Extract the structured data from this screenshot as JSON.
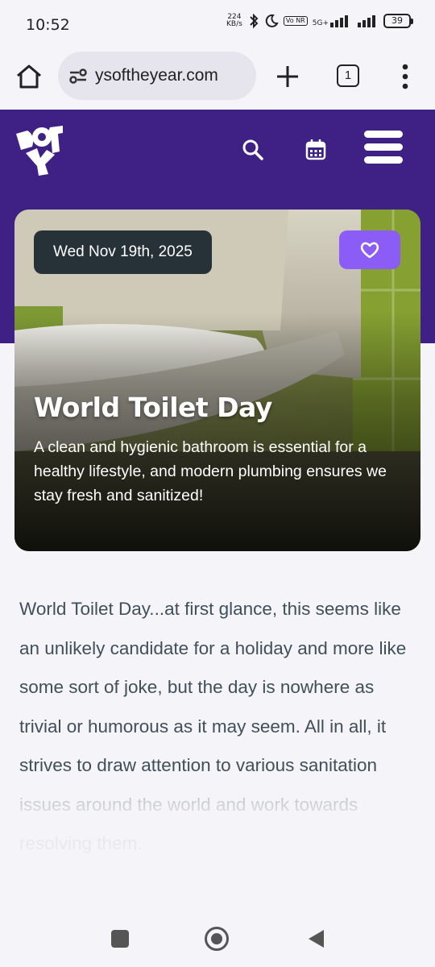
{
  "status_bar": {
    "time": "10:52",
    "net_speed_value": "224",
    "net_speed_unit": "KB/s",
    "volte": "Vo NR",
    "network": "5G+",
    "battery": "39",
    "icons": [
      "bluetooth-icon",
      "moon-icon",
      "signal-icon",
      "battery-icon"
    ]
  },
  "browser": {
    "url": "ysoftheyear.com",
    "tab_count": "1",
    "icons": [
      "home-icon",
      "site-settings-icon",
      "plus-icon",
      "tabs-icon",
      "more-vert-icon"
    ]
  },
  "site": {
    "logo_text": "DOTY",
    "brand_color": "#3f2186",
    "accent_color": "#8b5cf6",
    "icons": [
      "search-icon",
      "calendar-icon",
      "hamburger-menu-icon",
      "heart-icon"
    ]
  },
  "hero": {
    "date": "Wed Nov 19th, 2025",
    "title": "World Toilet Day",
    "description": "A clean and hygienic bathroom is essential for a healthy lifestyle, and modern plumbing ensures we stay fresh and sanitized!"
  },
  "article": {
    "paragraph": "World Toilet Day...at first glance, this seems like an unlikely candidate for a holiday and more like some sort of joke, but the day is nowhere as trivial or humorous as it may seem. All in all, it strives to draw attention to various sanitation issues around the world and work towards resolving them."
  },
  "nav": {
    "icons": [
      "recents-icon",
      "home-circle-icon",
      "back-icon"
    ]
  }
}
